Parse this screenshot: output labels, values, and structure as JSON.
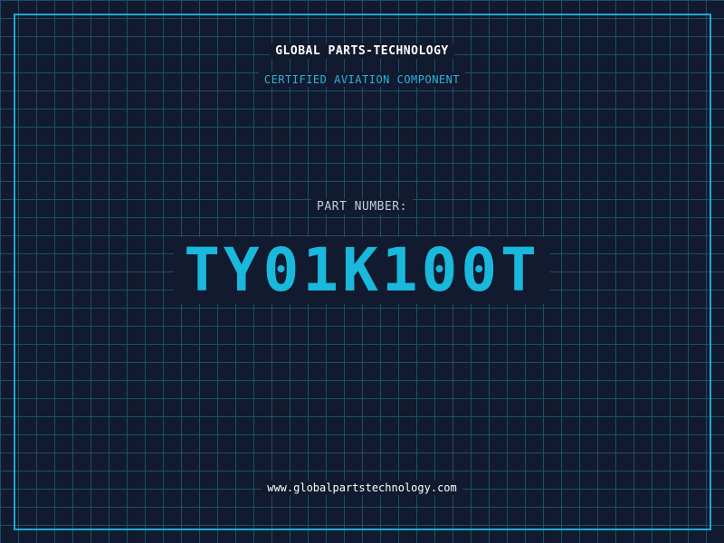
{
  "header": {
    "company": "GLOBAL PARTS-TECHNOLOGY",
    "tagline": "CERTIFIED AVIATION COMPONENT"
  },
  "main": {
    "part_label": "PART NUMBER:",
    "part_number": "TY01K100T"
  },
  "footer": {
    "url": "www.globalpartstechnology.com"
  },
  "colors": {
    "background": "#111a2e",
    "grid": "#1b4f6a",
    "accent": "#19b8dc",
    "frame": "#1fa8cf"
  }
}
